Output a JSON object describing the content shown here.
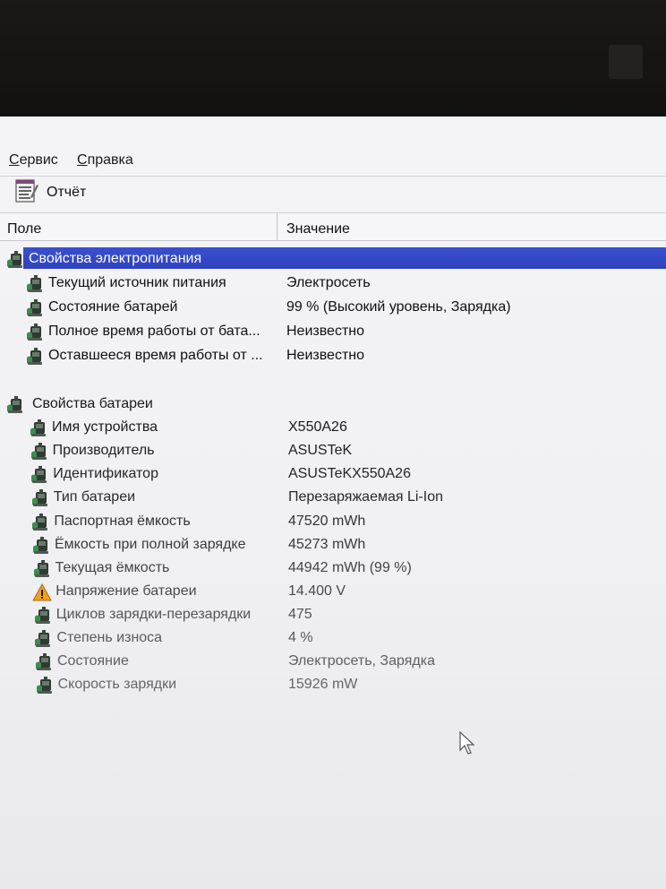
{
  "menu": {
    "items": [
      "Сервис",
      "Справка"
    ]
  },
  "toolbar": {
    "report_label": "Отчёт"
  },
  "columns": {
    "field": "Поле",
    "value": "Значение"
  },
  "sections": [
    {
      "title": "Свойства электропитания",
      "rows": [
        {
          "field": "Текущий источник питания",
          "value": "Электросеть",
          "icon": "battery-icon"
        },
        {
          "field": "Состояние батарей",
          "value": "99 % (Высокий уровень, Зарядка)",
          "icon": "battery-icon"
        },
        {
          "field": "Полное время работы от бата...",
          "value": "Неизвестно",
          "icon": "battery-icon"
        },
        {
          "field": "Оставшееся время работы от ...",
          "value": "Неизвестно",
          "icon": "battery-icon"
        }
      ]
    },
    {
      "title": "Свойства батареи",
      "rows": [
        {
          "field": "Имя устройства",
          "value": "X550A26",
          "icon": "battery-icon"
        },
        {
          "field": "Производитель",
          "value": "ASUSTeK",
          "icon": "battery-icon"
        },
        {
          "field": "Идентификатор",
          "value": "ASUSTeKX550A26",
          "icon": "battery-icon"
        },
        {
          "field": "Тип батареи",
          "value": "Перезаряжаемая Li-Ion",
          "icon": "battery-icon"
        },
        {
          "field": "Паспортная ёмкость",
          "value": "47520 mWh",
          "icon": "battery-icon"
        },
        {
          "field": "Ёмкость при полной зарядке",
          "value": "45273 mWh",
          "icon": "battery-icon"
        },
        {
          "field": "Текущая ёмкость",
          "value": "44942 mWh  (99 %)",
          "icon": "battery-icon"
        },
        {
          "field": "Напряжение батареи",
          "value": "14.400 V",
          "icon": "warning-icon"
        },
        {
          "field": "Циклов зарядки-перезарядки",
          "value": "475",
          "icon": "battery-icon"
        },
        {
          "field": "Степень износа",
          "value": "4 %",
          "icon": "battery-icon"
        },
        {
          "field": "Состояние",
          "value": "Электросеть, Зарядка",
          "icon": "battery-icon"
        },
        {
          "field": "Скорость зарядки",
          "value": "15926 mW",
          "icon": "battery-icon"
        }
      ]
    }
  ],
  "colors": {
    "selection": "#2f43c0",
    "background": "#f1f1f3",
    "text": "#111111"
  }
}
